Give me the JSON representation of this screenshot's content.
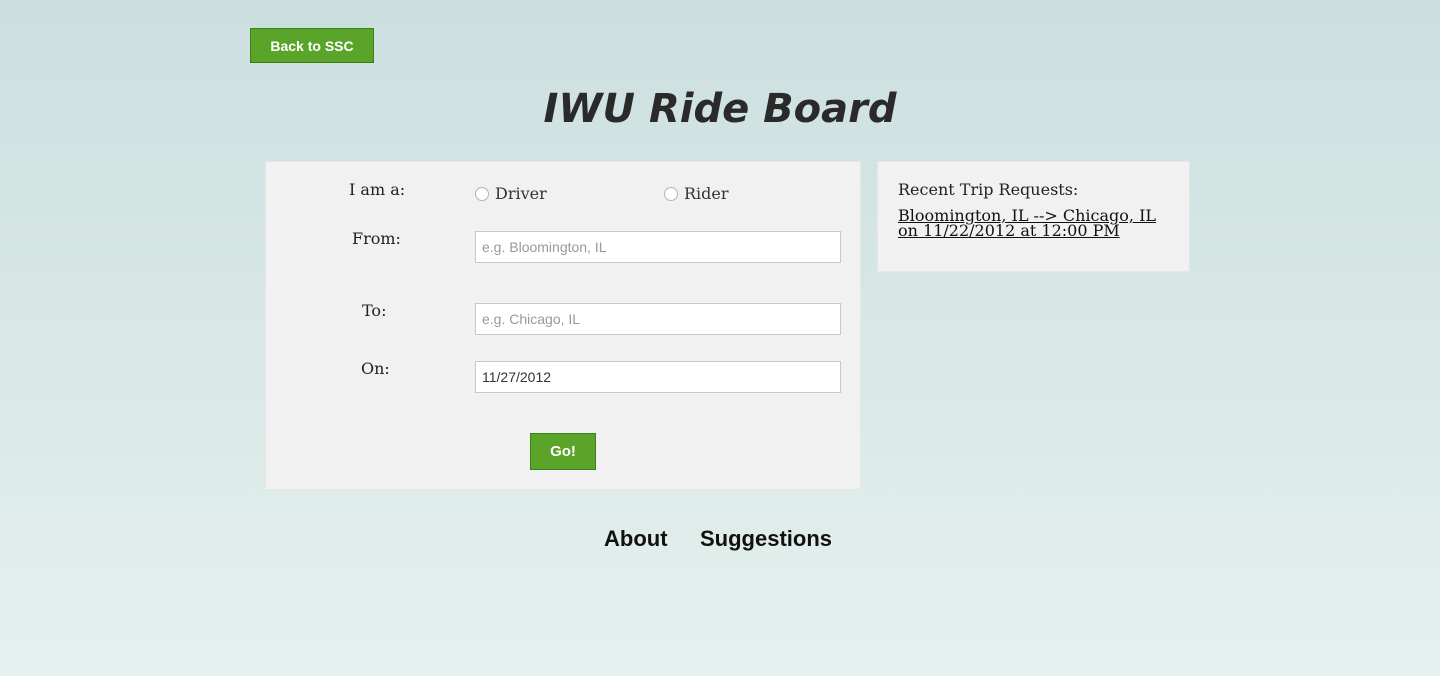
{
  "header": {
    "back_label": "Back to SSC",
    "title": "IWU Ride Board"
  },
  "form": {
    "role_label": "I am a:",
    "role_options": [
      "Driver",
      "Rider"
    ],
    "from_label": "From:",
    "from_placeholder": "e.g. Bloomington, IL",
    "to_label": "To:",
    "to_placeholder": "e.g. Chicago, IL",
    "on_label": "On:",
    "on_value": "11/27/2012",
    "submit_label": "Go!"
  },
  "recent": {
    "title": "Recent Trip Requests:",
    "items": [
      {
        "text": "Bloomington, IL --> Chicago, IL on 11/22/2012 at 12:00 PM"
      }
    ]
  },
  "footer": {
    "links": [
      "About",
      "Suggestions"
    ]
  },
  "colors": {
    "accent": "#5aa42a",
    "panel": "#f1f1f1"
  }
}
